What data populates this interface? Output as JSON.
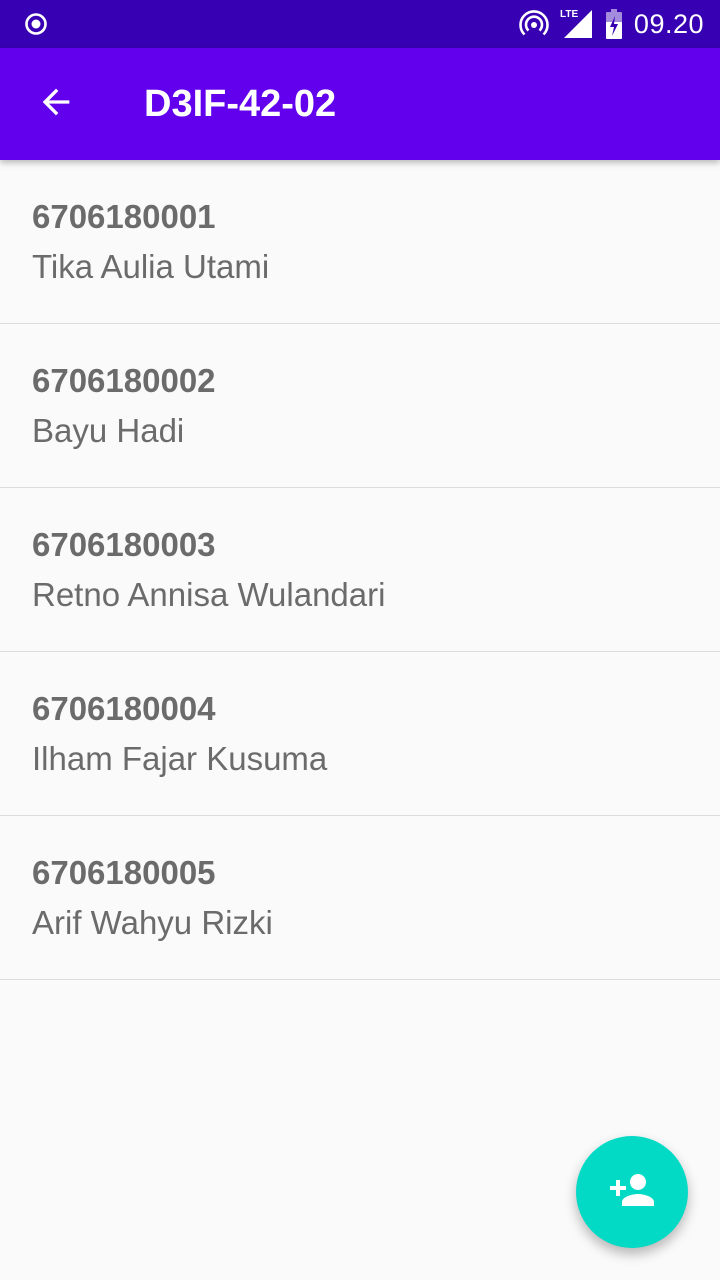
{
  "status_bar": {
    "left_icon": "record-circle-icon",
    "hotspot_icon": "hotspot-icon",
    "network_label": "LTE",
    "signal_icon": "signal-icon",
    "battery_icon": "battery-charging-icon",
    "time": "09.20"
  },
  "app_bar": {
    "back_icon": "arrow-back-icon",
    "title": "D3IF-42-02"
  },
  "students": [
    {
      "id": "6706180001",
      "name": "Tika Aulia Utami"
    },
    {
      "id": "6706180002",
      "name": "Bayu Hadi"
    },
    {
      "id": "6706180003",
      "name": "Retno Annisa Wulandari"
    },
    {
      "id": "6706180004",
      "name": "Ilham Fajar Kusuma"
    },
    {
      "id": "6706180005",
      "name": "Arif Wahyu Rizki"
    }
  ],
  "fab": {
    "icon": "person-add-icon"
  },
  "colors": {
    "status_bar": "#3700b3",
    "app_bar": "#6200ee",
    "fab": "#03dac5",
    "text": "#6b6b6b",
    "background": "#fafafa"
  }
}
